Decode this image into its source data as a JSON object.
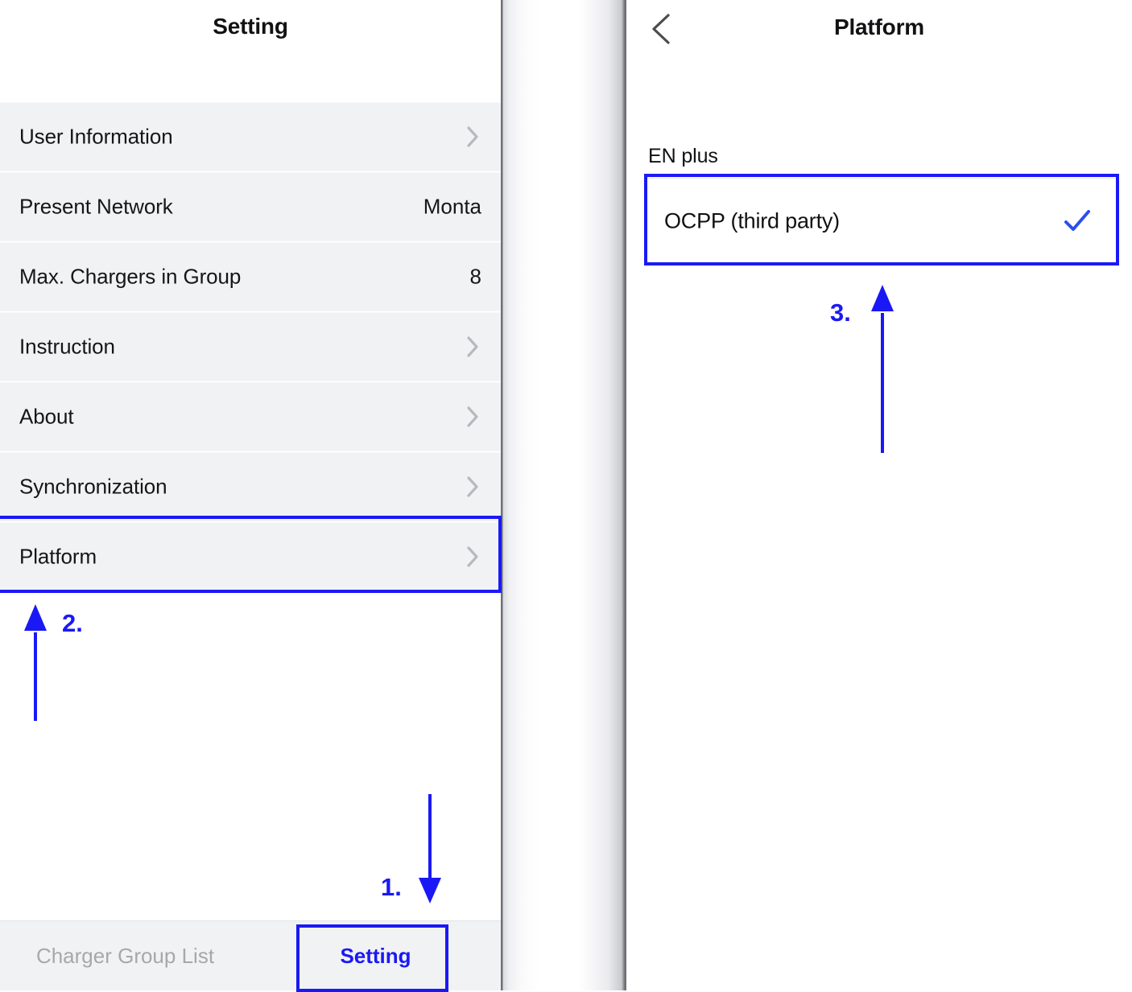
{
  "accent_color": "#1a19f5",
  "left_screen": {
    "header": {
      "title": "Setting"
    },
    "list": [
      {
        "label": "User Information",
        "value": "",
        "accessory": "chevron-right-icon"
      },
      {
        "label": "Present Network",
        "value": "Monta",
        "accessory": "value"
      },
      {
        "label": "Max. Chargers in Group",
        "value": "8",
        "accessory": "value"
      },
      {
        "label": "Instruction",
        "value": "",
        "accessory": "chevron-right-icon"
      },
      {
        "label": "About",
        "value": "",
        "accessory": "chevron-right-icon"
      },
      {
        "label": "Synchronization",
        "value": "",
        "accessory": "chevron-right-icon"
      },
      {
        "label": "Platform",
        "value": "",
        "accessory": "chevron-right-icon"
      }
    ],
    "tab_bar": {
      "tabs": [
        {
          "label": "Charger Group List",
          "state": "inactive"
        },
        {
          "label": "Setting",
          "state": "active"
        }
      ]
    }
  },
  "right_screen": {
    "header": {
      "back_icon": "chevron-left-icon",
      "title": "Platform"
    },
    "section_label": "EN plus",
    "options": [
      {
        "label": "OCPP (third party)",
        "selected": true,
        "check_icon": "checkmark-icon"
      }
    ]
  },
  "annotations": {
    "steps": [
      {
        "number": "1.",
        "target": "Setting tab",
        "arrow": "down"
      },
      {
        "number": "2.",
        "target": "Platform row",
        "arrow": "up"
      },
      {
        "number": "3.",
        "target": "OCPP (third party) option",
        "arrow": "up"
      }
    ]
  }
}
